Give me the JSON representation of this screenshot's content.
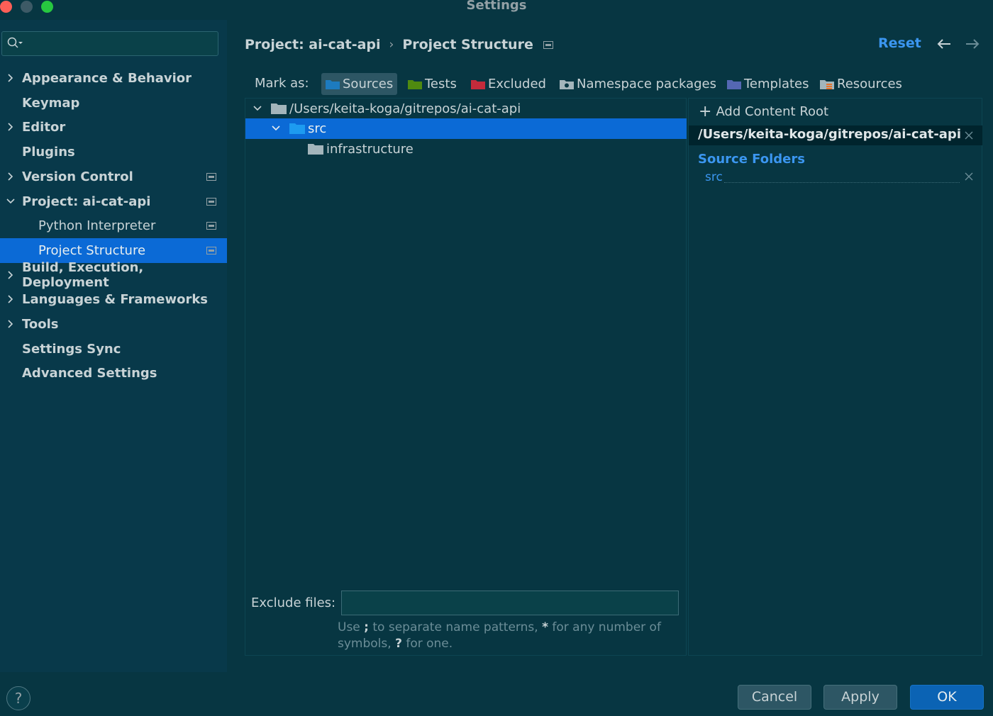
{
  "window": {
    "title": "Settings"
  },
  "search": {
    "placeholder": ""
  },
  "sidebar": {
    "items": [
      {
        "label": "Appearance & Behavior",
        "expandable": true,
        "expanded": false
      },
      {
        "label": "Keymap",
        "expandable": false
      },
      {
        "label": "Editor",
        "expandable": true,
        "expanded": false
      },
      {
        "label": "Plugins",
        "expandable": false
      },
      {
        "label": "Version Control",
        "expandable": true,
        "expanded": false,
        "project_icon": true
      },
      {
        "label": "Project: ai-cat-api",
        "expandable": true,
        "expanded": true,
        "project_icon": true
      },
      {
        "label": "Python Interpreter",
        "child": true,
        "project_icon": true
      },
      {
        "label": "Project Structure",
        "child": true,
        "selected": true,
        "project_icon": true
      },
      {
        "label": "Build, Execution, Deployment",
        "expandable": true,
        "expanded": false
      },
      {
        "label": "Languages & Frameworks",
        "expandable": true,
        "expanded": false
      },
      {
        "label": "Tools",
        "expandable": true,
        "expanded": false
      },
      {
        "label": "Settings Sync",
        "expandable": false
      },
      {
        "label": "Advanced Settings",
        "expandable": false
      }
    ]
  },
  "header": {
    "breadcrumb_parent": "Project: ai-cat-api",
    "breadcrumb_separator": "›",
    "breadcrumb_current": "Project Structure",
    "reset_label": "Reset"
  },
  "mark_as": {
    "label": "Mark as:",
    "buttons": [
      {
        "label": "Sources",
        "color": "#1d7bbf",
        "active": true
      },
      {
        "label": "Tests",
        "color": "#4f8a10"
      },
      {
        "label": "Excluded",
        "color": "#c42b3b"
      },
      {
        "label": "Namespace packages",
        "color": "#a3b5bb"
      },
      {
        "label": "Templates",
        "color": "#5467b3"
      },
      {
        "label": "Resources",
        "color": "#a3b5bb"
      }
    ]
  },
  "tree": {
    "rows": [
      {
        "label": "/Users/keita-koga/gitrepos/ai-cat-api",
        "expanded": true,
        "folder_color": "#a3b5bb"
      },
      {
        "label": "src",
        "expanded": true,
        "selected": true,
        "folder_color": "#1d9bf0"
      },
      {
        "label": "infrastructure",
        "folder_color": "#a3b5bb"
      }
    ]
  },
  "exclude": {
    "label": "Exclude files:",
    "value": "",
    "hint_prefix": "Use",
    "hint_sym1": ";",
    "hint_mid": "to separate name patterns,",
    "hint_sym2": "*",
    "hint_mid2": "for any number of symbols,",
    "hint_sym3": "?",
    "hint_suffix": "for one."
  },
  "content_root": {
    "add_label": "Add Content Root",
    "path": "/Users/keita-koga/gitrepos/ai-cat-api",
    "source_folders_title": "Source Folders",
    "source_folders": [
      "src"
    ]
  },
  "footer": {
    "help_label": "?",
    "cancel_label": "Cancel",
    "apply_label": "Apply",
    "ok_label": "OK"
  }
}
